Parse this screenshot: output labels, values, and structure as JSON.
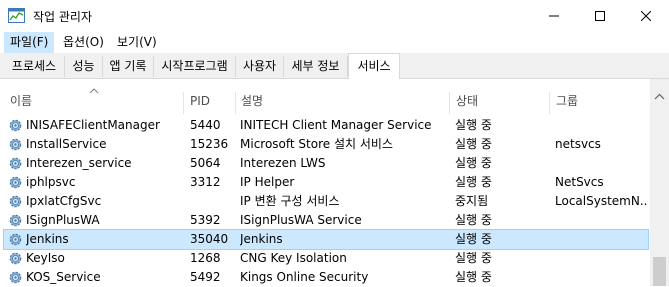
{
  "window": {
    "title": "작업 관리자"
  },
  "menu": [
    {
      "label": "파일(F)"
    },
    {
      "label": "옵션(O)"
    },
    {
      "label": "보기(V)"
    }
  ],
  "tabs": [
    {
      "label": "프로세스"
    },
    {
      "label": "성능"
    },
    {
      "label": "앱 기록"
    },
    {
      "label": "시작프로그램"
    },
    {
      "label": "사용자"
    },
    {
      "label": "세부 정보"
    },
    {
      "label": "서비스"
    }
  ],
  "columns": {
    "name": "이름",
    "pid": "PID",
    "description": "설명",
    "status": "상태",
    "group": "그룹"
  },
  "rows": [
    {
      "name": "INISAFEClientManager",
      "pid": "5440",
      "description": "INITECH Client Manager Service",
      "status": "실행 중",
      "group": ""
    },
    {
      "name": "InstallService",
      "pid": "15236",
      "description": "Microsoft Store 설치 서비스",
      "status": "실행 중",
      "group": "netsvcs"
    },
    {
      "name": "Interezen_service",
      "pid": "5064",
      "description": "Interezen LWS",
      "status": "실행 중",
      "group": ""
    },
    {
      "name": "iphlpsvc",
      "pid": "3312",
      "description": "IP Helper",
      "status": "실행 중",
      "group": "NetSvcs"
    },
    {
      "name": "IpxlatCfgSvc",
      "pid": "",
      "description": "IP 변환 구성 서비스",
      "status": "중지됨",
      "group": "LocalSystemN..."
    },
    {
      "name": "ISignPlusWA",
      "pid": "5392",
      "description": "ISignPlusWA Service",
      "status": "실행 중",
      "group": ""
    },
    {
      "name": "Jenkins",
      "pid": "35040",
      "description": "Jenkins",
      "status": "실행 중",
      "group": "",
      "selected": true
    },
    {
      "name": "KeyIso",
      "pid": "1268",
      "description": "CNG Key Isolation",
      "status": "실행 중",
      "group": ""
    },
    {
      "name": "KOS_Service",
      "pid": "5492",
      "description": "Kings Online Security",
      "status": "실행 중",
      "group": ""
    }
  ]
}
